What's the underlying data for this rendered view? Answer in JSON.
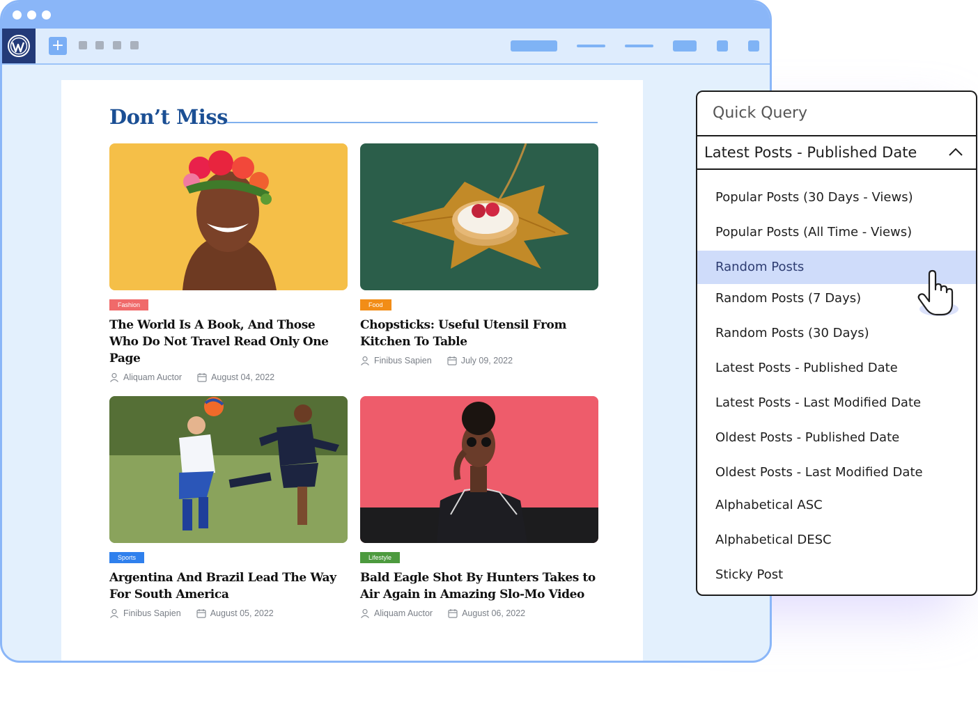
{
  "browser": {
    "toolbar": {
      "plus_label": "+"
    }
  },
  "section": {
    "title": "Don’t Miss"
  },
  "posts": [
    {
      "category": "Fashion",
      "category_color": "#f06a6a",
      "title": "The World Is A Book, And Those Who Do Not Travel Read Only One Page",
      "author": "Aliquam Auctor",
      "date": "August 04, 2022"
    },
    {
      "category": "Food",
      "category_color": "#f28d17",
      "title": "Chopsticks: Useful Utensil From Kitchen To Table",
      "author": "Finibus Sapien",
      "date": "July 09, 2022"
    },
    {
      "category": "Sports",
      "category_color": "#2f80ed",
      "title": "Argentina And Brazil Lead The Way For South America",
      "author": "Finibus Sapien",
      "date": "August 05, 2022"
    },
    {
      "category": "Lifestyle",
      "category_color": "#4c9a3e",
      "title": "Bald Eagle Shot By Hunters Takes to Air Again in Amazing Slo-Mo Video",
      "author": "Aliquam Auctor",
      "date": "August 06, 2022"
    }
  ],
  "query_panel": {
    "label": "Quick Query",
    "selected": "Latest Posts - Published Date",
    "options": [
      "Popular Posts (30 Days - Views)",
      "Popular Posts (All Time - Views)",
      "Random Posts",
      "Random Posts (7 Days)",
      "Random Posts (30 Days)",
      "Latest Posts - Published Date",
      "Latest Posts - Last Modified Date",
      "Oldest Posts - Published Date",
      "Oldest Posts - Last Modified Date",
      "Alphabetical ASC",
      "Alphabetical DESC",
      "Sticky Post"
    ],
    "highlighted_option": "Random Posts"
  },
  "colors": {
    "accent": "#1b4f94",
    "frame": "#8ab6f8",
    "highlight": "#cfdcfa"
  }
}
